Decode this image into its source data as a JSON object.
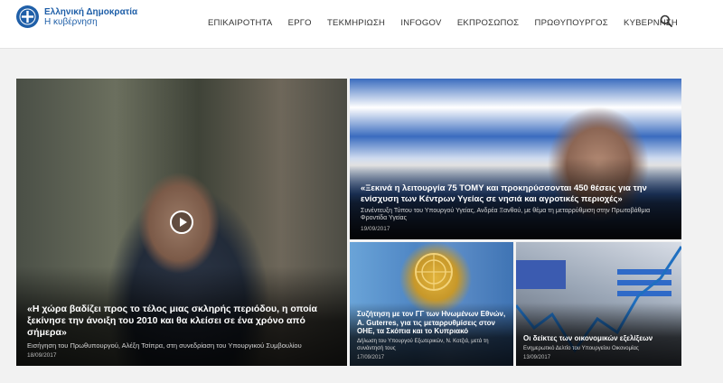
{
  "header": {
    "logo": {
      "line1": "Ελληνική Δημοκρατία",
      "line2": "Η κυβέρνηση"
    },
    "nav": [
      {
        "label": "ΕΠΙΚΑΙΡΟΤΗΤΑ"
      },
      {
        "label": "ΕΡΓΟ"
      },
      {
        "label": "ΤΕΚΜΗΡΙΩΣΗ"
      },
      {
        "label": "INFOGOV"
      },
      {
        "label": "ΕΚΠΡΟΣΩΠΟΣ"
      },
      {
        "label": "ΠΡΩΘΥΠΟΥΡΓΟΣ"
      },
      {
        "label": "ΚΥΒΕΡΝΗΣΗ"
      }
    ],
    "search_icon": "search-icon"
  },
  "tiles": {
    "main": {
      "headline": "«Η χώρα βαδίζει προς το τέλος μιας σκληρής περιόδου, η οποία ξεκίνησε την άνοιξη του 2010 και θα κλείσει σε ένα χρόνο από σήμερα»",
      "subtitle": "Εισήγηση του Πρωθυπουργού, Αλέξη Τσίπρα, στη συνεδρίαση του Υπουργικού Συμβουλίου",
      "date": "18/09/2017",
      "play_icon": "play-icon"
    },
    "health": {
      "headline": "«Ξεκινά η λειτουργία 75 ΤΟΜΥ και προκηρύσσονται 450 θέσεις για την ενίσχυση των Κέντρων Υγείας σε νησιά και αγροτικές περιοχές»",
      "subtitle": "Συνέντευξη Τύπου του Υπουργού Υγείας, Ανδρέα Ξανθού, με θέμα τη μεταρρύθμιση στην Πρωτοβάθμια Φροντίδα Υγείας",
      "date": "19/09/2017"
    },
    "un": {
      "headline": "Συζήτηση με τον ΓΓ των Ηνωμένων Εθνών, A. Guterres, για τις μεταρρυθμίσεις στον ΟΗΕ, τα Σκόπια και το Κυπριακό",
      "subtitle": "Δήλωση του Υπουργού Εξωτερικών, Ν. Κοτζιά, μετά τη συνάντησή τους",
      "date": "17/09/2017"
    },
    "economy": {
      "headline": "Οι δείκτες των οικονομικών εξελίξεων",
      "subtitle": "Ενημερωτικό Δελτίο του Υπουργείου Οικονομίας",
      "date": "13/09/2017"
    }
  }
}
